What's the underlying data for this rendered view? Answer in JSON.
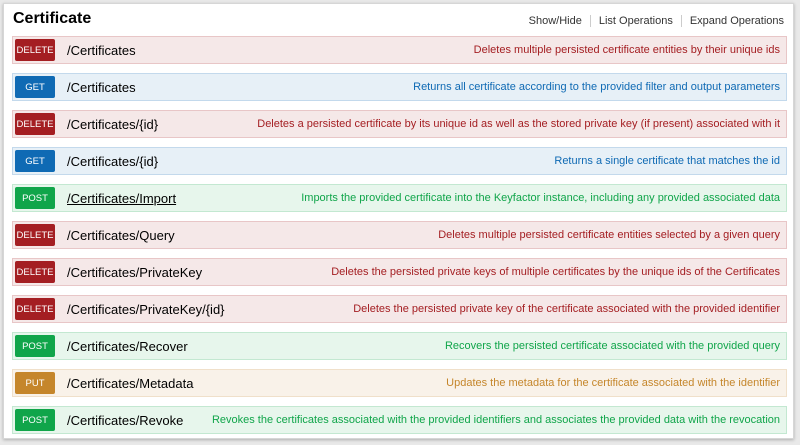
{
  "section": {
    "title": "Certificate",
    "links": [
      "Show/Hide",
      "List Operations",
      "Expand Operations"
    ]
  },
  "colors": {
    "delete": "#a41e22",
    "get": "#0f6ab4",
    "post": "#10a54a",
    "put": "#c5862b"
  },
  "operations": [
    {
      "method": "DELETE",
      "path": "/Certificates",
      "description": "Deletes multiple persisted certificate entities by their unique ids"
    },
    {
      "method": "GET",
      "path": "/Certificates",
      "description": "Returns all certificate according to the provided filter and output parameters"
    },
    {
      "method": "DELETE",
      "path": "/Certificates/{id}",
      "description": "Deletes a persisted certificate by its unique id as well as the stored private key (if present) associated with it"
    },
    {
      "method": "GET",
      "path": "/Certificates/{id}",
      "description": "Returns a single certificate that matches the id"
    },
    {
      "method": "POST",
      "path": "/Certificates/Import",
      "description": "Imports the provided certificate into the Keyfactor instance, including any provided associated data"
    },
    {
      "method": "DELETE",
      "path": "/Certificates/Query",
      "description": "Deletes multiple persisted certificate entities selected by a given query"
    },
    {
      "method": "DELETE",
      "path": "/Certificates/PrivateKey",
      "description": "Deletes the persisted private keys of multiple certificates by the unique ids of the Certificates"
    },
    {
      "method": "DELETE",
      "path": "/Certificates/PrivateKey/{id}",
      "description": "Deletes the persisted private key of the certificate associated with the provided identifier"
    },
    {
      "method": "POST",
      "path": "/Certificates/Recover",
      "description": "Recovers the persisted certificate associated with the provided query"
    },
    {
      "method": "PUT",
      "path": "/Certificates/Metadata",
      "description": "Updates the metadata for the certificate associated with the identifier"
    },
    {
      "method": "POST",
      "path": "/Certificates/Revoke",
      "description": "Revokes the certificates associated with the provided identifiers and associates the provided data with the revocation"
    }
  ]
}
